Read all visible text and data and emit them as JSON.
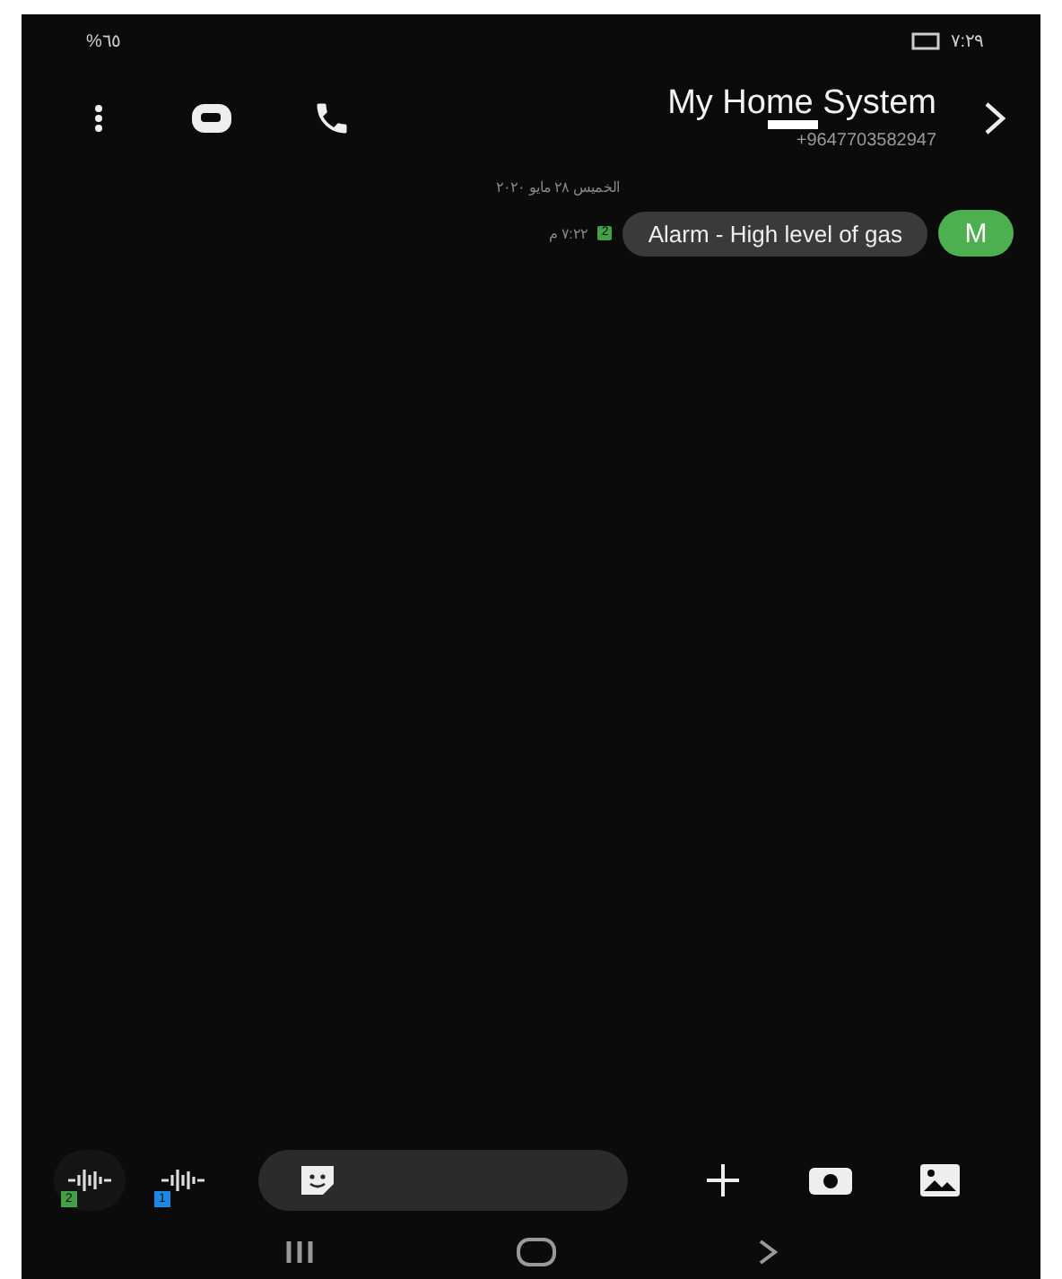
{
  "status_bar": {
    "indicators": "%٦٥",
    "time": "٧:٢٩"
  },
  "header": {
    "contact_name": "My Home System",
    "phone_number": "+9647703582947"
  },
  "date_separator": "الخميس ٢٨ مايو ٢٠٢٠",
  "messages": [
    {
      "sender_initial": "M",
      "text": "Alarm - High level of gas",
      "time": "٧:٢٢ م",
      "sim": "2"
    }
  ],
  "composer": {
    "voice_buttons": [
      {
        "sim": "1",
        "color": "#1e88e5"
      },
      {
        "sim": "2",
        "color": "#43a047"
      }
    ]
  }
}
